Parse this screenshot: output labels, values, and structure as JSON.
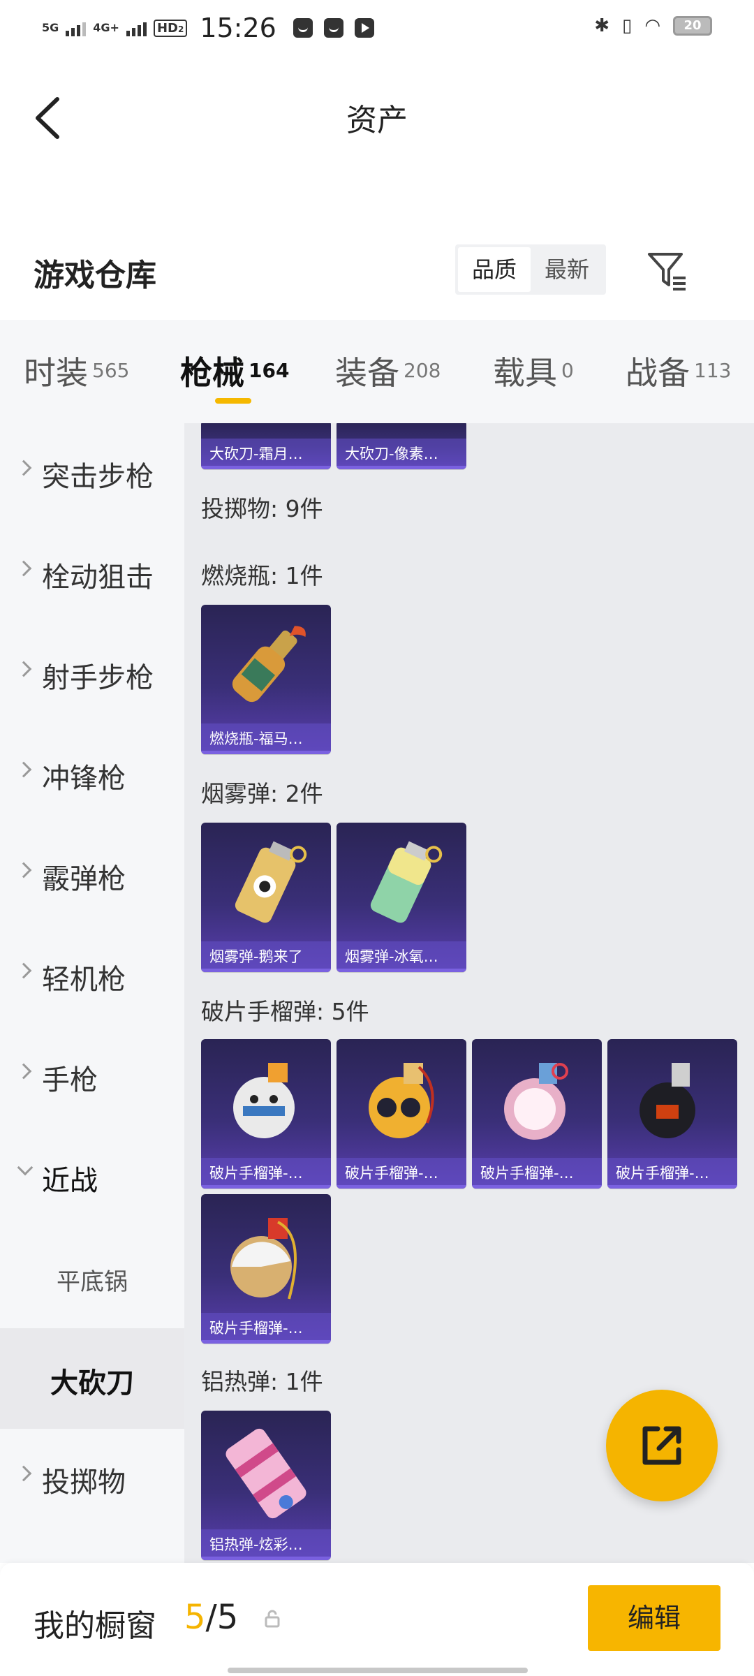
{
  "status_bar": {
    "sig1": "5G",
    "sig2": "4G+",
    "hd": "HD",
    "hd_sub": "2",
    "time": "15:26",
    "battery": "20"
  },
  "header": {
    "title": "资产"
  },
  "warehouse": {
    "title": "游戏仓库",
    "sort_options": [
      "品质",
      "最新"
    ],
    "active_sort": "品质"
  },
  "tabs": [
    {
      "label": "时装",
      "count": "565"
    },
    {
      "label": "枪械",
      "count": "164"
    },
    {
      "label": "装备",
      "count": "208"
    },
    {
      "label": "载具",
      "count": "0"
    },
    {
      "label": "战备",
      "count": "113"
    }
  ],
  "sidebar": {
    "items": [
      "突击步枪",
      "栓动狙击",
      "射手步枪",
      "冲锋枪",
      "霰弹枪",
      "轻机枪",
      "手枪"
    ],
    "expanded": "近战",
    "subitems": [
      "平底锅",
      "大砍刀"
    ],
    "after": "投掷物"
  },
  "content": {
    "top_cards": [
      "大砍刀-霜月…",
      "大砍刀-像素…"
    ],
    "group_title": "投掷物: 9件",
    "sections": [
      {
        "title": "燃烧瓶: 1件",
        "items": [
          "燃烧瓶-福马…"
        ]
      },
      {
        "title": "烟雾弹: 2件",
        "items": [
          "烟雾弹-鹅来了",
          "烟雾弹-冰氧…"
        ]
      },
      {
        "title": "破片手榴弹: 5件",
        "items": [
          "破片手榴弹-…",
          "破片手榴弹-…",
          "破片手榴弹-…",
          "破片手榴弹-…",
          "破片手榴弹-…"
        ]
      },
      {
        "title": "铝热弹: 1件",
        "items": [
          "铝热弹-炫彩…"
        ]
      }
    ]
  },
  "bottom": {
    "label": "我的橱窗",
    "current": "5",
    "total": "/5",
    "edit": "编辑"
  },
  "colors": {
    "accent": "#f5b400",
    "card_bg": "#3a2f78",
    "caption": "#7a61e0"
  }
}
